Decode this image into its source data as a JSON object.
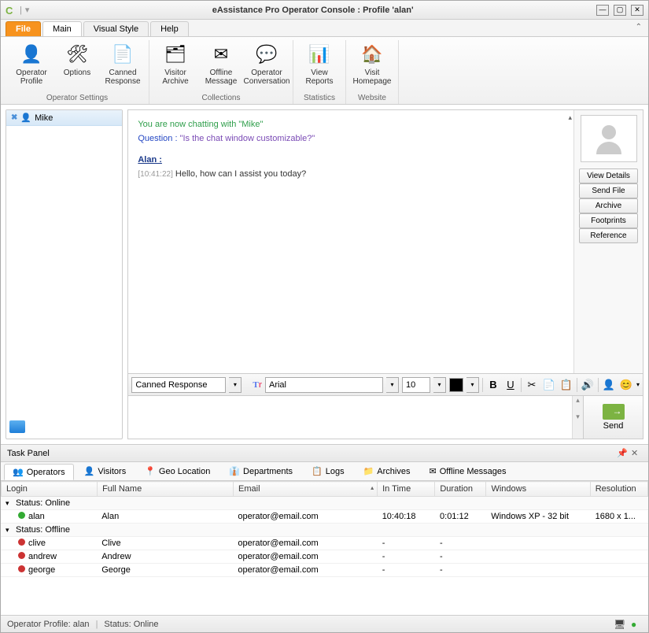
{
  "window": {
    "title": "eAssistance Pro Operator Console : Profile 'alan'"
  },
  "tabs": {
    "file": "File",
    "main": "Main",
    "visual_style": "Visual Style",
    "help": "Help"
  },
  "ribbon": {
    "groups": [
      {
        "label": "Operator Settings",
        "buttons": [
          {
            "id": "operator-profile",
            "label": "Operator\nProfile",
            "icon": "👤"
          },
          {
            "id": "options",
            "label": "Options",
            "icon": "🛠"
          },
          {
            "id": "canned-response",
            "label": "Canned\nResponse",
            "icon": "📄"
          }
        ]
      },
      {
        "label": "Collections",
        "buttons": [
          {
            "id": "visitor-archive",
            "label": "Visitor\nArchive",
            "icon": "🗂"
          },
          {
            "id": "offline-message",
            "label": "Offline\nMessage",
            "icon": "✉"
          },
          {
            "id": "operator-conversation",
            "label": "Operator\nConversation",
            "icon": "💬"
          }
        ]
      },
      {
        "label": "Statistics",
        "buttons": [
          {
            "id": "view-reports",
            "label": "View\nReports",
            "icon": "📊"
          }
        ]
      },
      {
        "label": "Website",
        "buttons": [
          {
            "id": "visit-homepage",
            "label": "Visit\nHomepage",
            "icon": "🏠"
          }
        ]
      }
    ]
  },
  "sidebar": {
    "visitors": [
      {
        "name": "Mike"
      }
    ]
  },
  "chat": {
    "system_line": "You are now chatting with \"Mike\"",
    "question_label": "Question :",
    "question_text": "\"Is the chat window customizable?\"",
    "sender": "Alan :",
    "timestamp": "[10:41:22]",
    "message": "Hello, how can I assist you today?"
  },
  "chat_side": {
    "buttons": [
      "View Details",
      "Send File",
      "Archive",
      "Footprints",
      "Reference"
    ]
  },
  "toolbar": {
    "canned_label": "Canned Response",
    "font": "Arial",
    "size": "10",
    "bold": "B",
    "underline": "U"
  },
  "send": {
    "label": "Send"
  },
  "task_panel": {
    "title": "Task Panel",
    "tabs": [
      "Operators",
      "Visitors",
      "Geo Location",
      "Departments",
      "Logs",
      "Archives",
      "Offline Messages"
    ],
    "tab_icons": [
      "👥",
      "👤",
      "📍",
      "👔",
      "📋",
      "📁",
      "✉"
    ],
    "columns": [
      "Login",
      "Full Name",
      "Email",
      "In Time",
      "Duration",
      "Windows",
      "Resolution"
    ],
    "groups": [
      {
        "label": "Status:  Online",
        "rows": [
          {
            "login": "alan",
            "full_name": "Alan",
            "email": "operator@email.com",
            "in_time": "10:40:18",
            "duration": "0:01:12",
            "windows": "Windows XP - 32 bit",
            "resolution": "1680 x 1...",
            "dot": "online"
          }
        ]
      },
      {
        "label": "Status:  Offline",
        "rows": [
          {
            "login": "clive",
            "full_name": "Clive",
            "email": "operator@email.com",
            "in_time": "-",
            "duration": "-",
            "windows": "",
            "resolution": "",
            "dot": "offline"
          },
          {
            "login": "andrew",
            "full_name": "Andrew",
            "email": "operator@email.com",
            "in_time": "-",
            "duration": "-",
            "windows": "",
            "resolution": "",
            "dot": "offline"
          },
          {
            "login": "george",
            "full_name": "George",
            "email": "operator@email.com",
            "in_time": "-",
            "duration": "-",
            "windows": "",
            "resolution": "",
            "dot": "offline"
          }
        ]
      }
    ]
  },
  "statusbar": {
    "profile_label": "Operator Profile: alan",
    "status_label": "Status: Online"
  }
}
